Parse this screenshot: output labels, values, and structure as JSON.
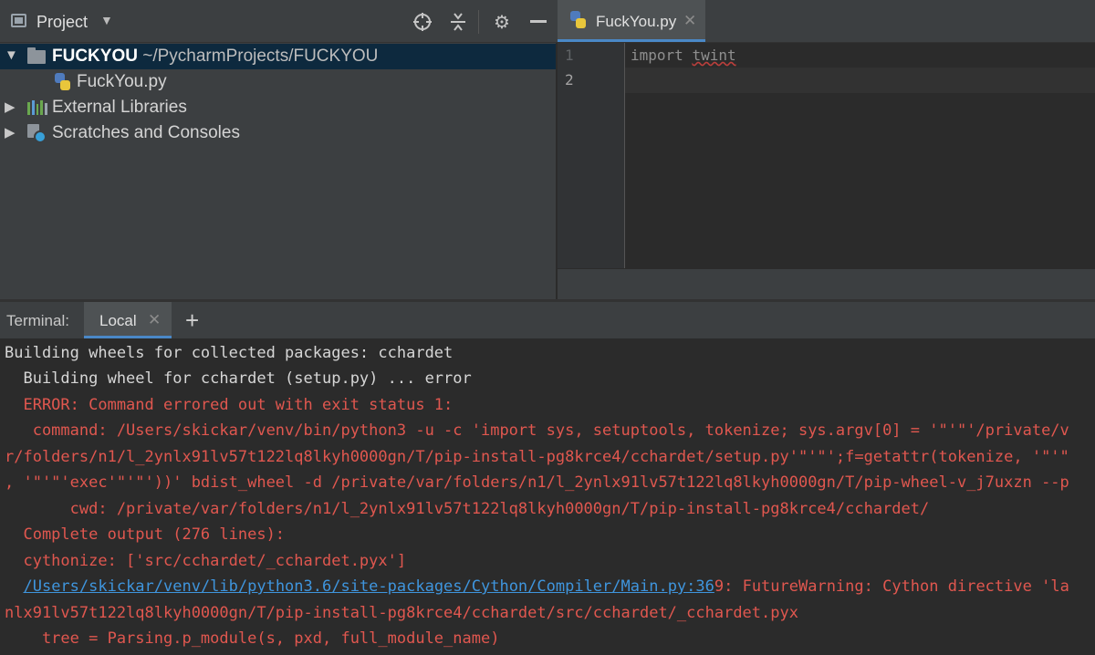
{
  "project_panel": {
    "title": "Project",
    "tree": [
      {
        "name": "FUCKYOU",
        "path": "~/PycharmProjects/FUCKYOU"
      },
      {
        "name": "FuckYou.py"
      },
      {
        "name": "External Libraries"
      },
      {
        "name": "Scratches and Consoles"
      }
    ]
  },
  "editor": {
    "tab_label": "FuckYou.py",
    "close_glyph": "✕",
    "line_numbers": [
      "1",
      "2"
    ],
    "code": {
      "keyword": "import",
      "module": "twint"
    }
  },
  "terminal": {
    "label": "Terminal:",
    "tab_label": "Local",
    "close_glyph": "✕",
    "add_glyph": "+",
    "lines": [
      "Building wheels for collected packages: cchardet",
      "  Building wheel for cchardet (setup.py) ... error",
      "  ERROR: Command errored out with exit status 1:",
      "   command: /Users/skickar/venv/bin/python3 -u -c 'import sys, setuptools, tokenize; sys.argv[0] = '\"'\"'/private/v",
      "r/folders/n1/l_2ynlx91lv57t122lq8lkyh0000gn/T/pip-install-pg8krce4/cchardet/setup.py'\"'\"';f=getattr(tokenize, '\"'\"",
      ", '\"'\"'exec'\"'\"'))' bdist_wheel -d /private/var/folders/n1/l_2ynlx91lv57t122lq8lkyh0000gn/T/pip-wheel-v_j7uxzn --p",
      "       cwd: /private/var/folders/n1/l_2ynlx91lv57t122lq8lkyh0000gn/T/pip-install-pg8krce4/cchardet/",
      "  Complete output (276 lines):",
      "  cythonize: ['src/cchardet/_cchardet.pyx']",
      "nlx91lv57t122lq8lkyh0000gn/T/pip-install-pg8krce4/cchardet/src/cchardet/_cchardet.pyx",
      "    tree = Parsing.p_module(s, pxd, full_module_name)"
    ],
    "warning_link": "/Users/skickar/venv/lib/python3.6/site-packages/Cython/Compiler/Main.py:36",
    "warning_rest": "9: FutureWarning: Cython directive 'la"
  },
  "colors": {
    "accent": "#4a88c7",
    "error_text": "#e0574f",
    "link": "#3f95dd",
    "selection": "#0d293e"
  },
  "icons": [
    "project-window-icon",
    "chevron-down-icon",
    "locate-crosshair-icon",
    "collapse-all-icon",
    "gear-icon",
    "minimize-icon",
    "folder-icon",
    "python-file-icon",
    "library-icon",
    "scratches-icon"
  ]
}
